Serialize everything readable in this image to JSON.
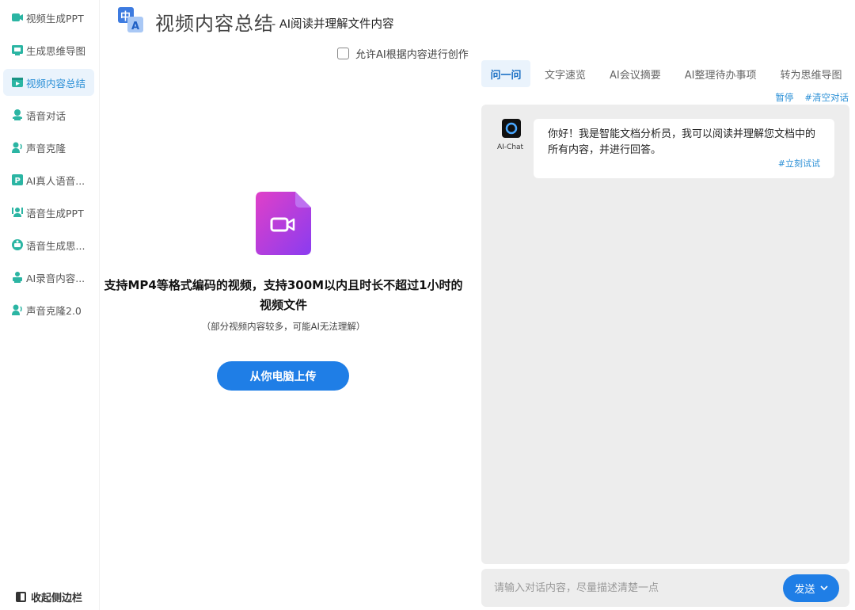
{
  "sidebar": {
    "items": [
      {
        "label": "视频生成PPT",
        "icon": "video-icon",
        "active": false
      },
      {
        "label": "生成思维导图",
        "icon": "mindmap-icon",
        "active": false
      },
      {
        "label": "视频内容总结",
        "icon": "video-summary-icon",
        "active": true
      },
      {
        "label": "语音对话",
        "icon": "voice-chat-icon",
        "active": false
      },
      {
        "label": "声音克隆",
        "icon": "voice-clone-icon",
        "active": false
      },
      {
        "label": "AI真人语音...",
        "icon": "ai-voice-icon",
        "active": false
      },
      {
        "label": "语音生成PPT",
        "icon": "voice-ppt-icon",
        "active": false
      },
      {
        "label": "语音生成思...",
        "icon": "voice-mindmap-icon",
        "active": false
      },
      {
        "label": "AI录音内容...",
        "icon": "recording-icon",
        "active": false
      },
      {
        "label": "声音克隆2.0",
        "icon": "voice-clone-icon",
        "active": false
      }
    ],
    "collapse_label": "收起侧边栏"
  },
  "header": {
    "title": "视频内容总结",
    "subtitle": "- AI阅读并理解文件内容",
    "logo_icon": "translate-logo-icon"
  },
  "options": {
    "allow_label": "允许AI根据内容进行创作",
    "allow_checked": false
  },
  "upload": {
    "main_text": "支持MP4等格式编码的视频，支持300M以内且时长不超过1小时的视频文件",
    "sub_text": "（部分视频内容较多，可能AI无法理解）",
    "button_label": "从你电脑上传"
  },
  "tabs": [
    {
      "label": "问一问",
      "active": true
    },
    {
      "label": "文字速览",
      "active": false
    },
    {
      "label": "AI会议摘要",
      "active": false
    },
    {
      "label": "AI整理待办事项",
      "active": false
    },
    {
      "label": "转为思维导图",
      "active": false
    }
  ],
  "chat": {
    "pause_label": "暂停",
    "clear_label": "#清空对话",
    "bot_name": "AI-Chat",
    "greeting": "你好！我是智能文档分析员，我可以阅读并理解您文档中的所有内容，并进行回答。",
    "try_label": "#立刻试试",
    "input_placeholder": "请输入对话内容，尽量描述清楚一点",
    "send_label": "发送"
  },
  "colors": {
    "accent": "#1f7ee6",
    "active_bg": "#eaf3fc",
    "link": "#2a8fd6",
    "chat_bg": "#ededed",
    "sidebar_icon_teal": "#2bb5a3",
    "file_icon_pink": "#e040c8",
    "file_icon_purple": "#8a3cf0"
  }
}
